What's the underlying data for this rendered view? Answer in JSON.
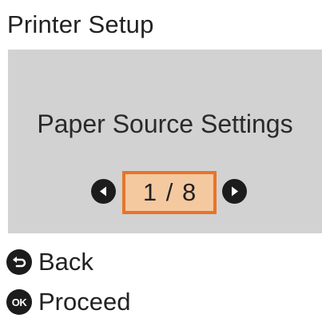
{
  "header": {
    "title": "Printer Setup"
  },
  "menu": {
    "current_item": "Paper Source Settings",
    "pager": {
      "current": "1",
      "separator": "/",
      "total": "8",
      "prev_icon": "chevron-left-circle-icon",
      "next_icon": "chevron-right-circle-icon"
    }
  },
  "softkeys": {
    "back": {
      "icon": "back-arrow-icon",
      "label": "Back"
    },
    "ok": {
      "icon": "ok-button-icon",
      "icon_text": "OK",
      "label": "Proceed"
    }
  },
  "colors": {
    "panel_background": "#d2d2d2",
    "highlight_border": "#e8742a",
    "highlight_fill": "#f4c9a0",
    "icon": "#1c1c1c",
    "text": "#222222"
  }
}
